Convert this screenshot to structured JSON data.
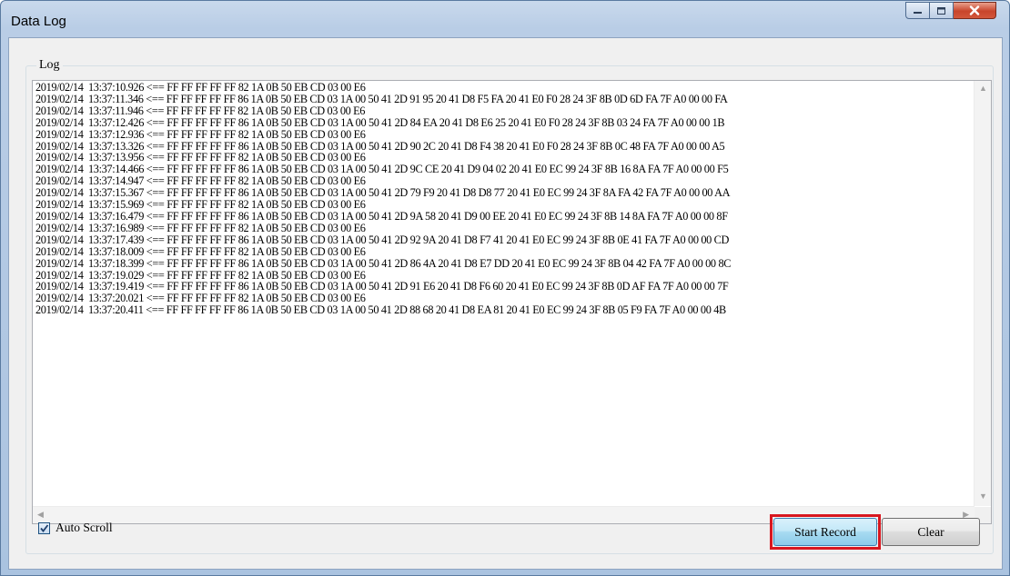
{
  "window": {
    "title": "Data Log",
    "controls": {
      "minimize": "minimize-icon",
      "maximize": "maximize-icon",
      "close": "close-icon"
    }
  },
  "log_group": {
    "label": "Log",
    "lines": [
      "2019/02/14  13:37:10.926 <== FF FF FF FF FF 82 1A 0B 50 EB CD 03 00 E6",
      "2019/02/14  13:37:11.346 <== FF FF FF FF FF 86 1A 0B 50 EB CD 03 1A 00 50 41 2D 91 95 20 41 D8 F5 FA 20 41 E0 F0 28 24 3F 8B 0D 6D FA 7F A0 00 00 FA",
      "2019/02/14  13:37:11.946 <== FF FF FF FF FF 82 1A 0B 50 EB CD 03 00 E6",
      "2019/02/14  13:37:12.426 <== FF FF FF FF FF 86 1A 0B 50 EB CD 03 1A 00 50 41 2D 84 EA 20 41 D8 E6 25 20 41 E0 F0 28 24 3F 8B 03 24 FA 7F A0 00 00 1B",
      "2019/02/14  13:37:12.936 <== FF FF FF FF FF 82 1A 0B 50 EB CD 03 00 E6",
      "2019/02/14  13:37:13.326 <== FF FF FF FF FF 86 1A 0B 50 EB CD 03 1A 00 50 41 2D 90 2C 20 41 D8 F4 38 20 41 E0 F0 28 24 3F 8B 0C 48 FA 7F A0 00 00 A5",
      "2019/02/14  13:37:13.956 <== FF FF FF FF FF 82 1A 0B 50 EB CD 03 00 E6",
      "2019/02/14  13:37:14.466 <== FF FF FF FF FF 86 1A 0B 50 EB CD 03 1A 00 50 41 2D 9C CE 20 41 D9 04 02 20 41 E0 EC 99 24 3F 8B 16 8A FA 7F A0 00 00 F5",
      "2019/02/14  13:37:14.947 <== FF FF FF FF FF 82 1A 0B 50 EB CD 03 00 E6",
      "2019/02/14  13:37:15.367 <== FF FF FF FF FF 86 1A 0B 50 EB CD 03 1A 00 50 41 2D 79 F9 20 41 D8 D8 77 20 41 E0 EC 99 24 3F 8A FA 42 FA 7F A0 00 00 AA",
      "2019/02/14  13:37:15.969 <== FF FF FF FF FF 82 1A 0B 50 EB CD 03 00 E6",
      "2019/02/14  13:37:16.479 <== FF FF FF FF FF 86 1A 0B 50 EB CD 03 1A 00 50 41 2D 9A 58 20 41 D9 00 EE 20 41 E0 EC 99 24 3F 8B 14 8A FA 7F A0 00 00 8F",
      "2019/02/14  13:37:16.989 <== FF FF FF FF FF 82 1A 0B 50 EB CD 03 00 E6",
      "2019/02/14  13:37:17.439 <== FF FF FF FF FF 86 1A 0B 50 EB CD 03 1A 00 50 41 2D 92 9A 20 41 D8 F7 41 20 41 E0 EC 99 24 3F 8B 0E 41 FA 7F A0 00 00 CD",
      "2019/02/14  13:37:18.009 <== FF FF FF FF FF 82 1A 0B 50 EB CD 03 00 E6",
      "2019/02/14  13:37:18.399 <== FF FF FF FF FF 86 1A 0B 50 EB CD 03 1A 00 50 41 2D 86 4A 20 41 D8 E7 DD 20 41 E0 EC 99 24 3F 8B 04 42 FA 7F A0 00 00 8C",
      "2019/02/14  13:37:19.029 <== FF FF FF FF FF 82 1A 0B 50 EB CD 03 00 E6",
      "2019/02/14  13:37:19.419 <== FF FF FF FF FF 86 1A 0B 50 EB CD 03 1A 00 50 41 2D 91 E6 20 41 D8 F6 60 20 41 E0 EC 99 24 3F 8B 0D AF FA 7F A0 00 00 7F",
      "2019/02/14  13:37:20.021 <== FF FF FF FF FF 82 1A 0B 50 EB CD 03 00 E6",
      "2019/02/14  13:37:20.411 <== FF FF FF FF FF 86 1A 0B 50 EB CD 03 1A 00 50 41 2D 88 68 20 41 D8 EA 81 20 41 E0 EC 99 24 3F 8B 05 F9 FA 7F A0 00 00 4B"
    ]
  },
  "auto_scroll": {
    "label": "Auto Scroll",
    "checked": true
  },
  "buttons": {
    "start_record": "Start Record",
    "clear": "Clear"
  },
  "colors": {
    "highlight": "#d8171f",
    "accent": "#3c7fb1"
  }
}
